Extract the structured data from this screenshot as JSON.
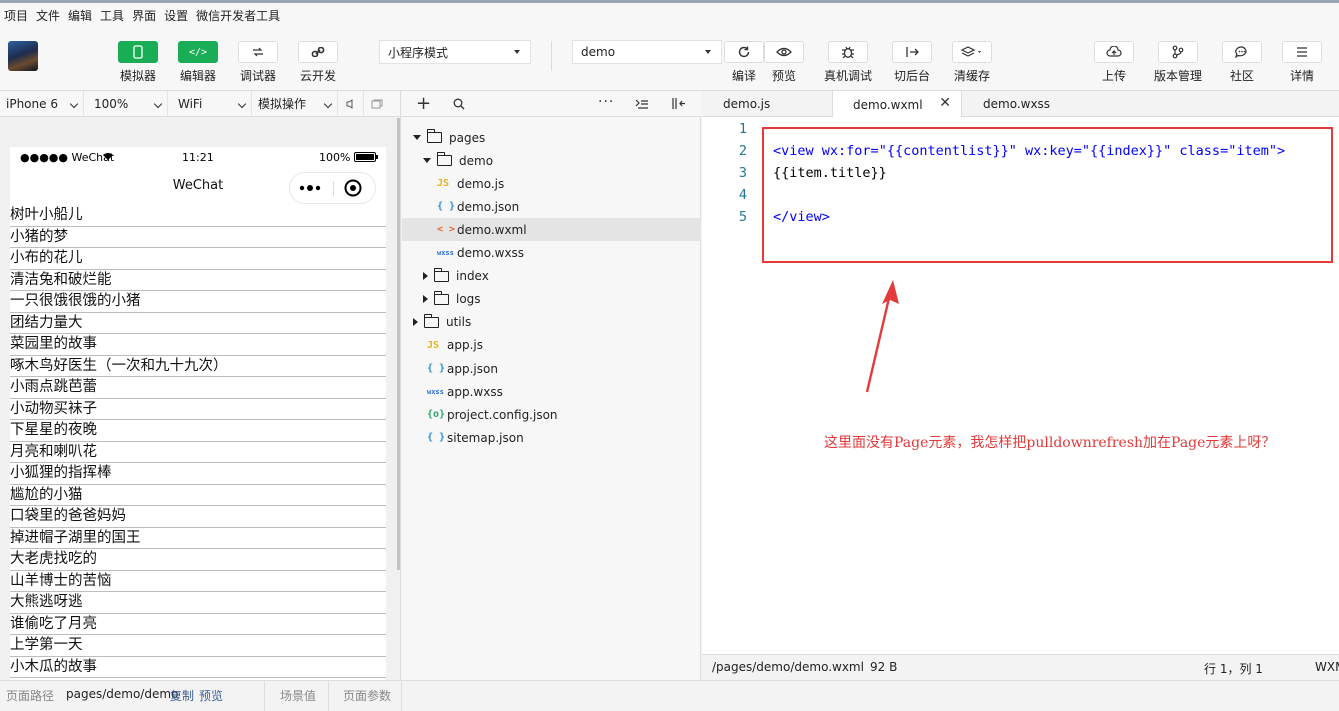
{
  "menu": [
    "项目",
    "文件",
    "编辑",
    "工具",
    "界面",
    "设置",
    "微信开发者工具"
  ],
  "toolbar": {
    "buttons": [
      {
        "label": "模拟器",
        "icon": "phone-icon",
        "active": true
      },
      {
        "label": "编辑器",
        "icon": "code-icon",
        "active": true
      },
      {
        "label": "调试器",
        "icon": "debugger-icon",
        "active": false
      },
      {
        "label": "云开发",
        "icon": "cloud-link-icon",
        "active": false
      }
    ],
    "mode_select": "小程序模式",
    "compile_select": "demo",
    "actions": [
      {
        "label": "编译",
        "icon": "refresh-icon"
      },
      {
        "label": "预览",
        "icon": "eye-icon"
      },
      {
        "label": "真机调试",
        "icon": "bug-icon"
      },
      {
        "label": "切后台",
        "icon": "switch-icon"
      },
      {
        "label": "清缓存",
        "icon": "layers-icon"
      }
    ],
    "right_actions": [
      {
        "label": "上传",
        "icon": "upload-icon"
      },
      {
        "label": "版本管理",
        "icon": "branch-icon"
      },
      {
        "label": "社区",
        "icon": "chat-icon"
      },
      {
        "label": "详情",
        "icon": "menu-icon"
      }
    ]
  },
  "simulator": {
    "device": "iPhone 6",
    "zoom": "100%",
    "network": "WiFi",
    "operation": "模拟操作",
    "status_left": "●●●●● WeChat",
    "time": "11:21",
    "battery": "100%",
    "nav_title": "WeChat",
    "items": [
      "树叶小船儿",
      "小猪的梦",
      "小布的花儿",
      "清洁兔和破烂能",
      "一只很饿很饿的小猪",
      "团结力量大",
      "菜园里的故事",
      "啄木鸟好医生（一次和九十九次）",
      "小雨点跳芭蕾",
      "小动物买袜子",
      "下星星的夜晚",
      "月亮和喇叭花",
      "小狐狸的指挥棒",
      "尴尬的小猫",
      "口袋里的爸爸妈妈",
      "掉进帽子湖里的国王",
      "大老虎找吃的",
      "山羊博士的苦恼",
      "大熊逃呀逃",
      "谁偷吃了月亮",
      "上学第一天",
      "小木瓜的故事"
    ]
  },
  "tree": [
    {
      "name": "pages",
      "type": "folder",
      "open": true,
      "level": 0
    },
    {
      "name": "demo",
      "type": "folder",
      "open": true,
      "level": 1
    },
    {
      "name": "demo.js",
      "type": "js",
      "level": 2
    },
    {
      "name": "demo.json",
      "type": "json",
      "level": 2
    },
    {
      "name": "demo.wxml",
      "type": "wxml",
      "level": 2,
      "selected": true
    },
    {
      "name": "demo.wxss",
      "type": "wxss",
      "level": 2
    },
    {
      "name": "index",
      "type": "folder",
      "open": false,
      "level": 1
    },
    {
      "name": "logs",
      "type": "folder",
      "open": false,
      "level": 1
    },
    {
      "name": "utils",
      "type": "folder",
      "open": false,
      "level": 0
    },
    {
      "name": "app.js",
      "type": "js",
      "level": 1
    },
    {
      "name": "app.json",
      "type": "json",
      "level": 1
    },
    {
      "name": "app.wxss",
      "type": "wxss",
      "level": 1
    },
    {
      "name": "project.config.json",
      "type": "config",
      "level": 1
    },
    {
      "name": "sitemap.json",
      "type": "json",
      "level": 1
    }
  ],
  "file_icons": {
    "js": "JS",
    "json": "{ }",
    "wxml": "< >",
    "wxss": "wxss",
    "config": "{o}"
  },
  "icon_colors": {
    "js": "#e8b21c",
    "json": "#2f8fd8",
    "wxml": "#e46a2a",
    "wxss": "#2f6fd8",
    "config": "#2aa56a"
  },
  "tabs": [
    "demo.js",
    "demo.wxml",
    "demo.wxss"
  ],
  "active_tab": "demo.wxml",
  "code": {
    "line_numbers": [
      "1",
      "2",
      "3",
      "4",
      "5"
    ],
    "l2_tag": "<view ",
    "l2_a1": "wx:for=",
    "l2_v1": "\"{{contentlist}}\"",
    "l2_a2": " wx:key=",
    "l2_v2": "\"{{index}}\"",
    "l2_a3": " class=",
    "l2_v3": "\"item\"",
    "l2_end": ">",
    "l3": "{{item.title}}",
    "l5": "</view>"
  },
  "annotation": "这里面没有Page元素，我怎样把pulldownrefresh加在Page元素上呀？",
  "editor_status": {
    "path": "/pages/demo/demo.wxml",
    "size": "92 B",
    "position": "行 1，列 1",
    "lang": "WXM"
  },
  "bottom": {
    "path_label": "页面路径",
    "path": "pages/demo/demo",
    "copy": "复制",
    "preview": "预览",
    "scene": "场景值",
    "params": "页面参数"
  },
  "colors": {
    "green": "#19ad55",
    "annotation_red": "#e33b3b"
  }
}
